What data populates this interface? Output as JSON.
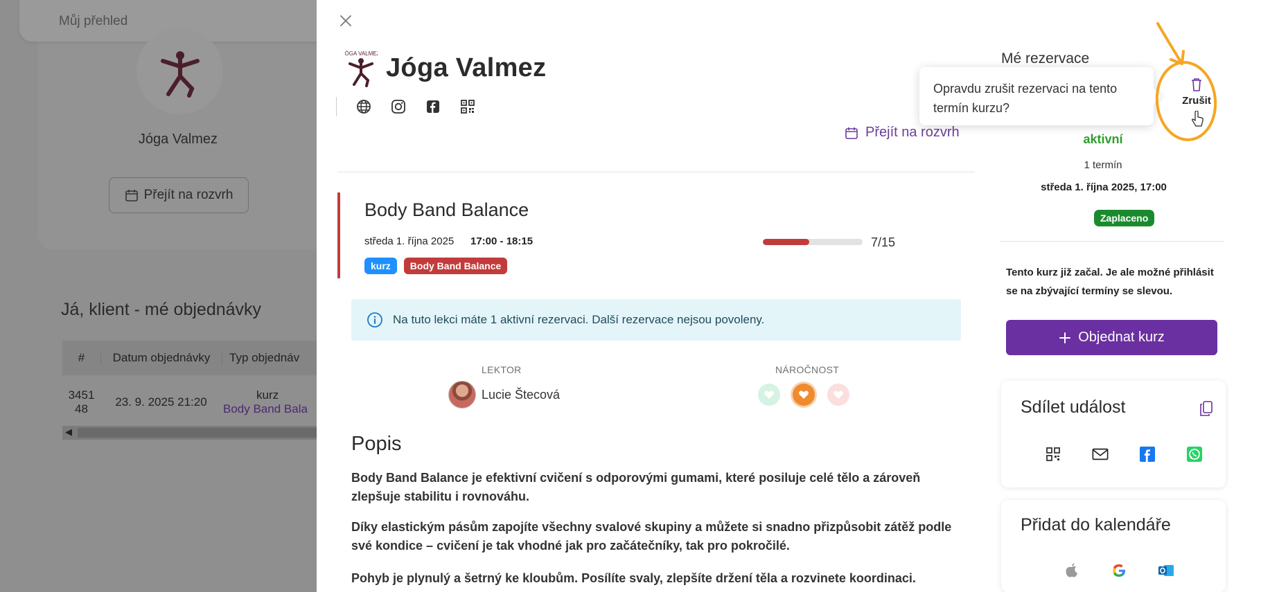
{
  "background": {
    "topbar_title": "Můj přehled",
    "studio_name": "Jóga Valmez",
    "schedule_button": "Přejít na rozvrh",
    "section_title": "Já, klient - mé objednávky",
    "table": {
      "headers": [
        "#",
        "Datum objednávky",
        "Typ objednáv"
      ],
      "row": {
        "id": "345148",
        "date": "23. 9. 2025 21:20",
        "type": "kurz",
        "type_link": "Body Band Bala"
      }
    }
  },
  "drawer": {
    "brand": {
      "name": "Jóga Valmez",
      "logo_text": "JÓGA VALMEZ"
    },
    "links": [
      "globe-icon",
      "instagram-icon",
      "facebook-icon",
      "qr-code-icon"
    ],
    "schedule_link": "Přejít na rozvrh",
    "event": {
      "title": "Body Band Balance",
      "date": "středa 1. října 2025",
      "time": "17:00 - 18:15",
      "tags": [
        "kurz",
        "Body Band Balance"
      ],
      "capacity": {
        "booked": 7,
        "total": 15,
        "label": "7/15"
      }
    },
    "alert": "Na tuto lekci máte 1 aktivní rezervaci. Další rezervace nejsou povoleny.",
    "lector_label": "LEKTOR",
    "lector_name": "Lucie Štecová",
    "difficulty_label": "NÁROČNOST",
    "difficulty_level": 2,
    "popis_title": "Popis",
    "popis": [
      "Body Band Balance je efektivní cvičení s odporovými gumami, které posiluje celé tělo a zároveň zlepšuje stabilitu i rovnováhu.",
      "Díky elastickým pásům zapojíte všechny svalové skupiny a můžete si snadno přizpůsobit zátěž podle své kondice – cvičení je tak vhodné jak pro začátečníky, tak pro pokročilé.",
      "Pohyb je plynulý a šetrný ke kloubům. Posílíte svaly, zlepšíte držení těla a rozvinete koordinaci."
    ]
  },
  "reservations": {
    "title": "Mé rezervace",
    "popover": "Opravdu zrušit rezervaci na tento termín kurzu?",
    "cancel_label": "Zrušit",
    "status": "aktivní",
    "term_count": "1 termín",
    "term_date": "středa 1. října 2025, 17:00",
    "paid": "Zaplaceno",
    "started_note": "Tento kurz již začal. Je ale možné přihlásit se na zbývající termíny se slevou.",
    "order_button": "Objednat kurz"
  },
  "share": {
    "title": "Sdílet událost",
    "icons": [
      "qr-code-icon",
      "mail-icon",
      "facebook-icon",
      "whatsapp-icon"
    ]
  },
  "calendar": {
    "title": "Přidat do kalendáře",
    "icons": [
      "apple-icon",
      "google-icon",
      "outlook-icon"
    ]
  },
  "colors": {
    "accent": "#6a2fa0",
    "event_red": "#c23b3b",
    "tag_blue": "#1e90ff",
    "status_green": "#2e9e2e",
    "paid_green": "#1b8a2e",
    "alert_bg": "#e4f5fa",
    "annotation": "#f5a623"
  }
}
